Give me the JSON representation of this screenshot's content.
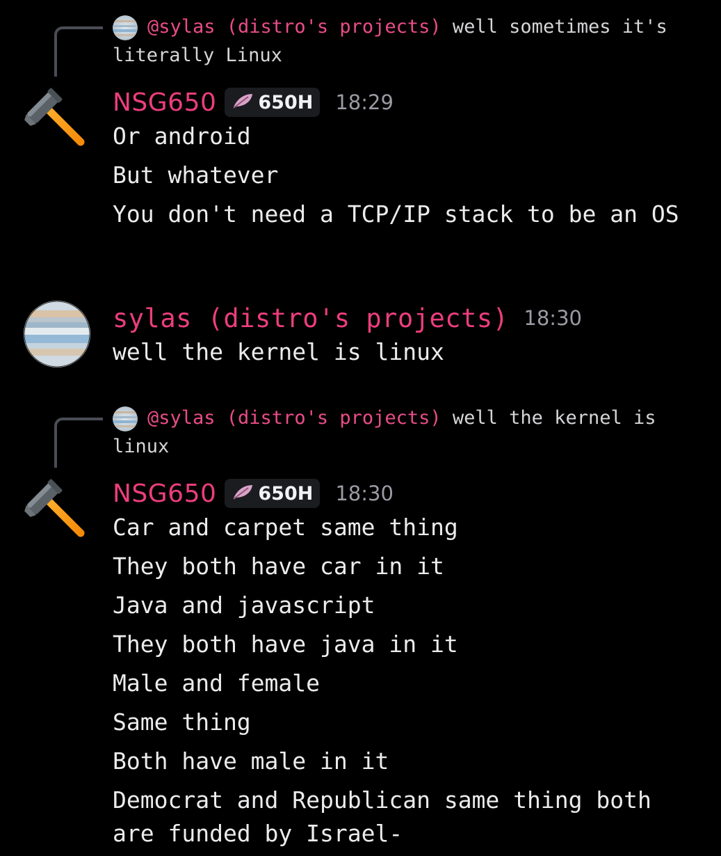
{
  "messages": [
    {
      "reply": {
        "mention": "@sylas (distro's projects)",
        "text": " well sometimes it's literally Linux"
      },
      "author": "NSG650",
      "tag": "650H",
      "time": "18:29",
      "avatar_icon": "hammer-icon",
      "lines": [
        "Or android",
        "But whatever",
        "You don't need a TCP/IP stack to be an OS"
      ]
    },
    {
      "author": "sylas (distro's projects)",
      "time": "18:30",
      "avatar_icon": "jupiter-avatar",
      "lines": [
        "well the kernel is linux"
      ]
    },
    {
      "reply": {
        "mention": "@sylas (distro's projects)",
        "text": " well the kernel is linux"
      },
      "author": "NSG650",
      "tag": "650H",
      "time": "18:30",
      "avatar_icon": "hammer-icon",
      "lines": [
        "Car and carpet same thing",
        "They both have car in it",
        "Java and javascript",
        "They both have java in it",
        "Male and female",
        "Same thing",
        "Both have male in it",
        "Democrat and Republican same thing both are funded by Israel-"
      ]
    }
  ],
  "colors": {
    "username": "#ec3e7c",
    "background": "#000000",
    "timestamp": "#9a9ba3"
  }
}
